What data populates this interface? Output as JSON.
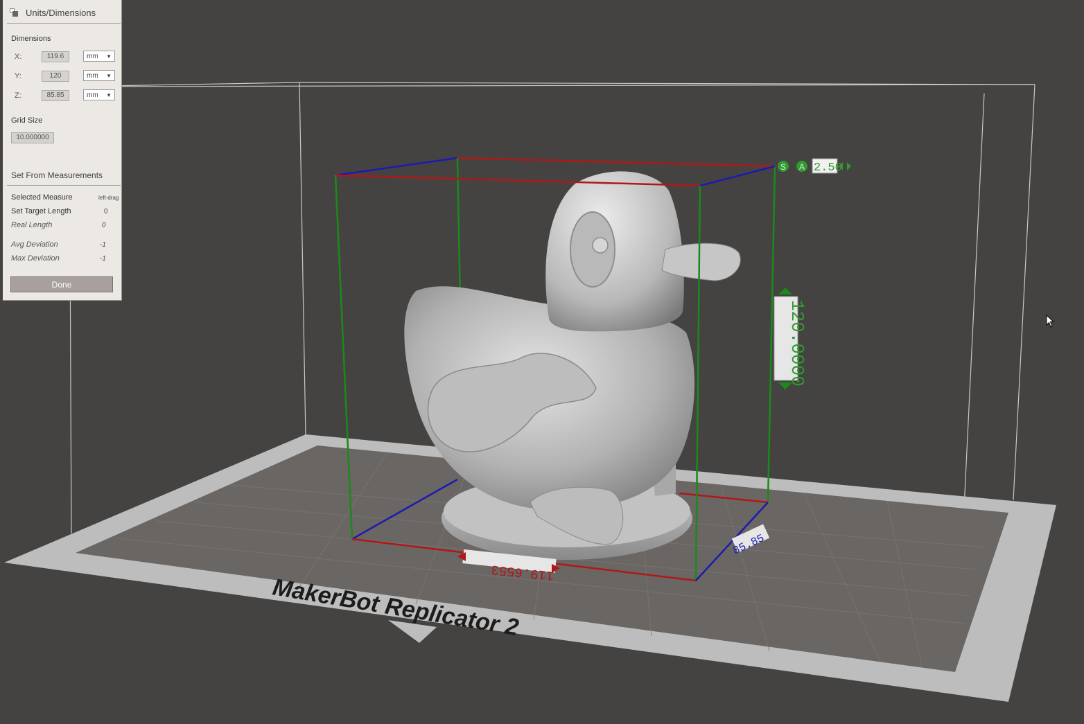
{
  "panel": {
    "title": "Units/Dimensions",
    "dimensions_label": "Dimensions",
    "x": {
      "label": "X:",
      "value": "119.6",
      "unit": "mm"
    },
    "y": {
      "label": "Y:",
      "value": "120",
      "unit": "mm"
    },
    "z": {
      "label": "Z:",
      "value": "85.85",
      "unit": "mm"
    },
    "grid_size_label": "Grid Size",
    "grid_size_value": "10.000000",
    "set_from_measurements": "Set From Measurements",
    "selected_measure_label": "Selected Measure",
    "selected_measure_value": "left-drag",
    "set_target_length_label": "Set Target Length",
    "set_target_length_value": "0",
    "real_length_label": "Real Length",
    "real_length_value": "0",
    "avg_deviation_label": "Avg Deviation",
    "avg_deviation_value": "-1",
    "max_deviation_label": "Max Deviation",
    "max_deviation_value": "-1",
    "done_label": "Done"
  },
  "viewport": {
    "platform_label": "MakerBot Replicator 2",
    "height_readout": "120.0000",
    "width_readout": "119.6553",
    "depth_readout": "85.85",
    "scale_readout": "2.50",
    "scale_icon": "S",
    "axis_icon": "A"
  },
  "colors": {
    "background": "#454341",
    "bbox_red": "#b01818",
    "bbox_green": "#1a8a1a",
    "bbox_blue": "#1b1bb0",
    "bed": "#b9b9b9",
    "readout_green": "#2f9a2f"
  }
}
